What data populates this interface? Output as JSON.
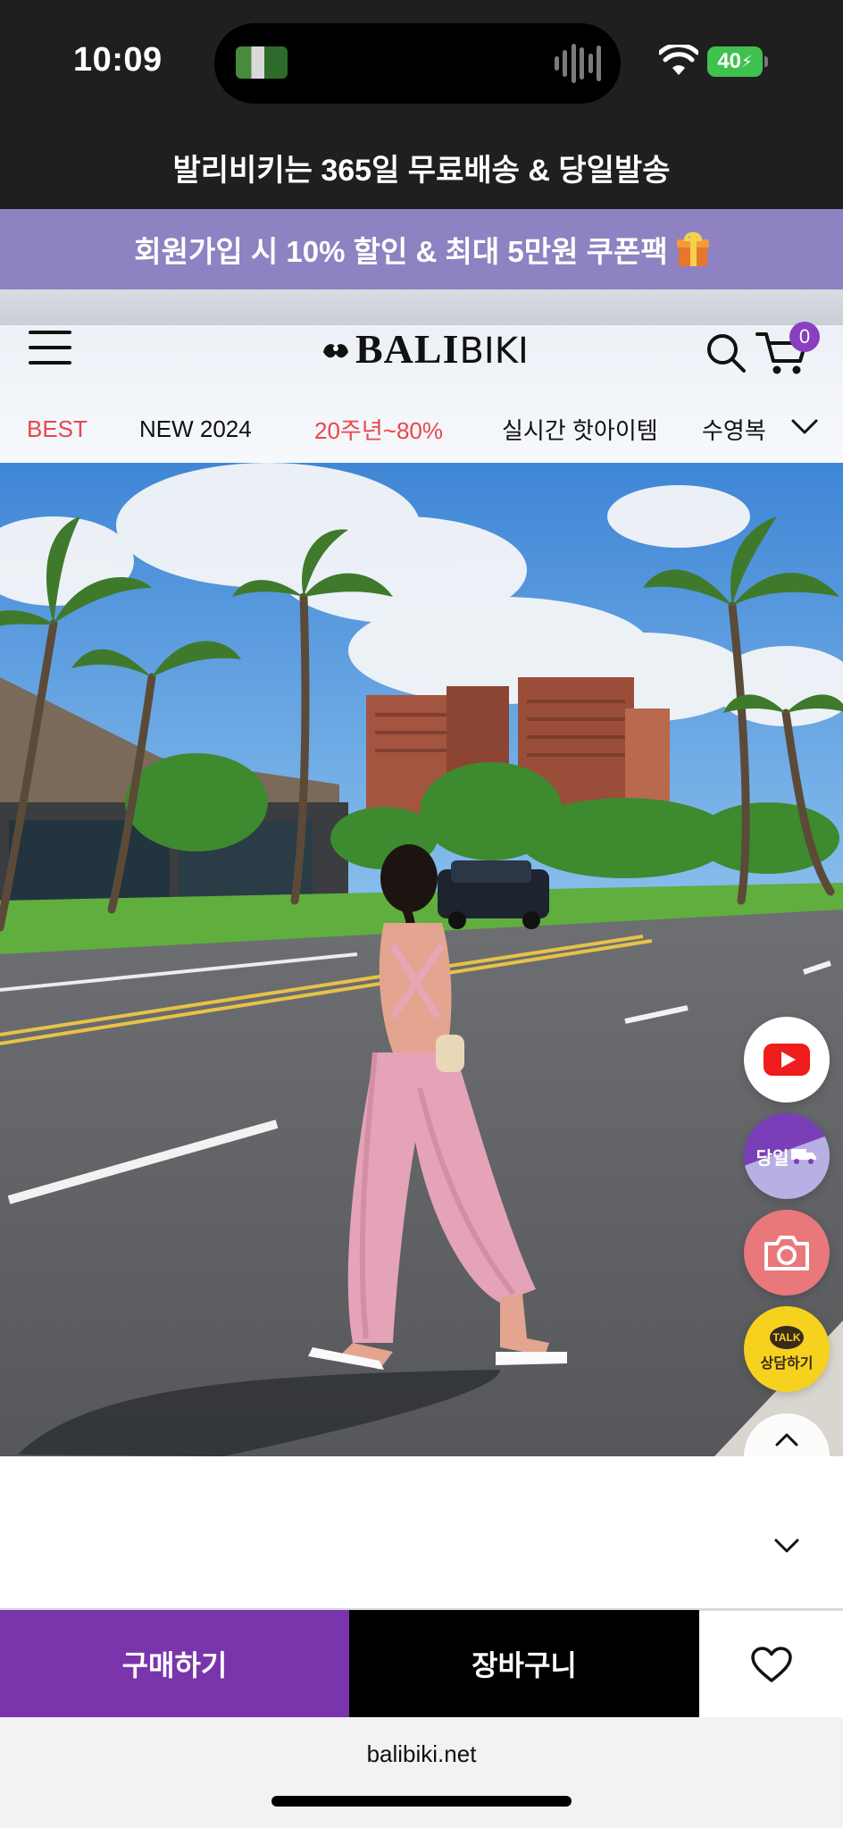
{
  "status_bar": {
    "time": "10:09",
    "battery": "40"
  },
  "banners": {
    "shipping": "발리비키는 365일 무료배송 & 당일발송",
    "promo": "회원가입 시 10% 할인 & 최대 5만원 쿠폰팩"
  },
  "header": {
    "logo_bold": "BALI",
    "logo_light": "BIKI",
    "cart_count": "0"
  },
  "nav": {
    "items": [
      {
        "label": "BEST",
        "color": "#e8474c"
      },
      {
        "label": "NEW 2024",
        "color": "#111111"
      },
      {
        "label": "20주년~80%",
        "color": "#e8474c"
      },
      {
        "label": "실시간 핫아이템",
        "color": "#111111"
      },
      {
        "label": "수영복",
        "color": "#111111"
      }
    ]
  },
  "floating": {
    "sameday": "당일",
    "talk_bubble": "TALK",
    "talk_label": "상담하기"
  },
  "actions": {
    "buy": "구매하기",
    "cart": "장바구니"
  },
  "browser": {
    "url": "balibiki.net"
  },
  "colors": {
    "promo_bg": "#8e82c2",
    "buy_bg": "#7a35ac",
    "accent_red": "#e8474c"
  }
}
